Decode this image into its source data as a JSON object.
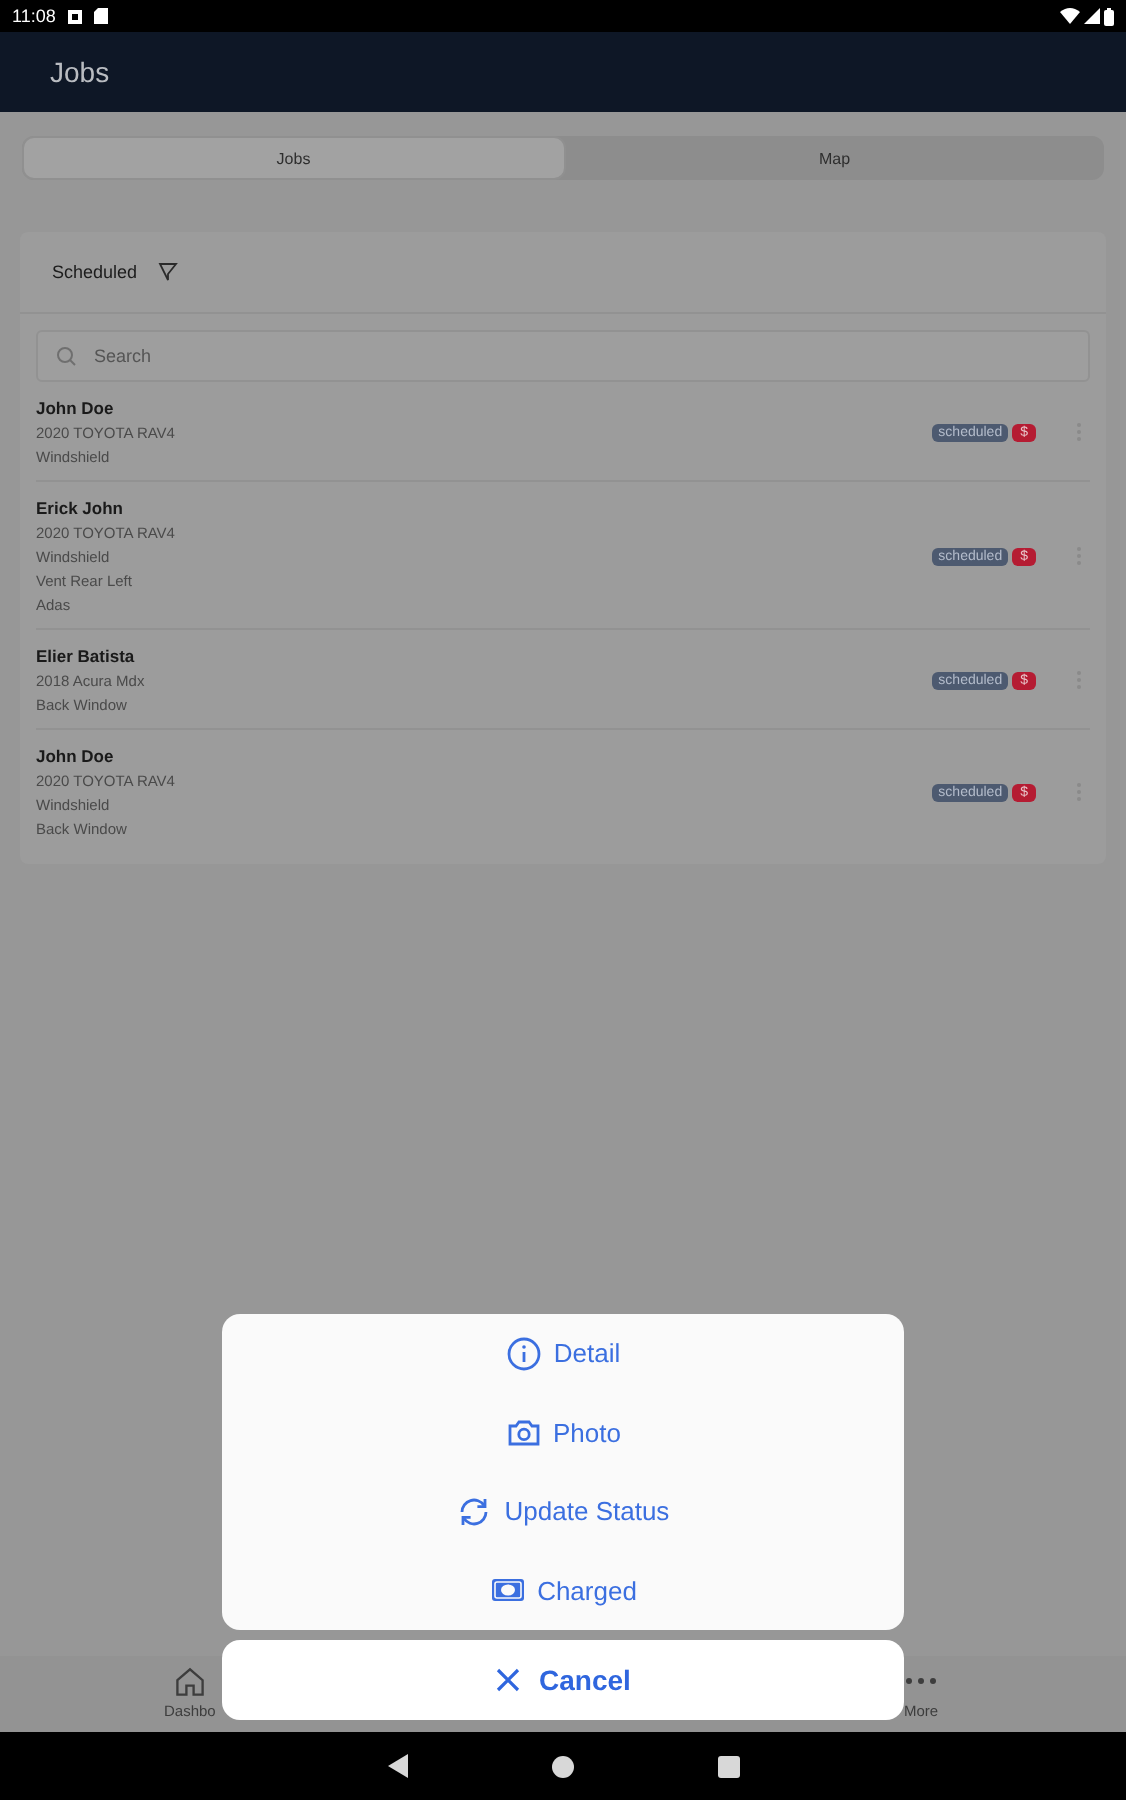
{
  "status_bar": {
    "time": "11:08"
  },
  "header": {
    "title": "Jobs"
  },
  "tabs": [
    {
      "label": "Jobs",
      "selected": true
    },
    {
      "label": "Map",
      "selected": false
    }
  ],
  "filter": {
    "label": "Scheduled"
  },
  "search": {
    "placeholder": "Search"
  },
  "jobs": [
    {
      "name": "John Doe",
      "lines": [
        "2020 TOYOTA RAV4",
        "Windshield"
      ],
      "status": "scheduled",
      "badge": "$"
    },
    {
      "name": "Erick John",
      "lines": [
        "2020 TOYOTA RAV4",
        "Windshield",
        "Vent Rear Left",
        "Adas"
      ],
      "status": "scheduled",
      "badge": "$"
    },
    {
      "name": "Elier Batista",
      "lines": [
        "2018 Acura Mdx",
        "Back Window"
      ],
      "status": "scheduled",
      "badge": "$"
    },
    {
      "name": "John Doe",
      "lines": [
        "2020 TOYOTA RAV4",
        "Windshield",
        "Back Window"
      ],
      "status": "scheduled",
      "badge": "$"
    }
  ],
  "bottom_nav": [
    {
      "label": "Dashbo",
      "kind": "home"
    },
    {
      "label": "More",
      "kind": "more"
    }
  ],
  "action_sheet": {
    "actions": [
      {
        "label": "Detail",
        "kind": "info"
      },
      {
        "label": "Photo",
        "kind": "camera"
      },
      {
        "label": "Update Status",
        "kind": "sync"
      },
      {
        "label": "Charged",
        "kind": "money"
      }
    ],
    "cancel": "Cancel"
  }
}
